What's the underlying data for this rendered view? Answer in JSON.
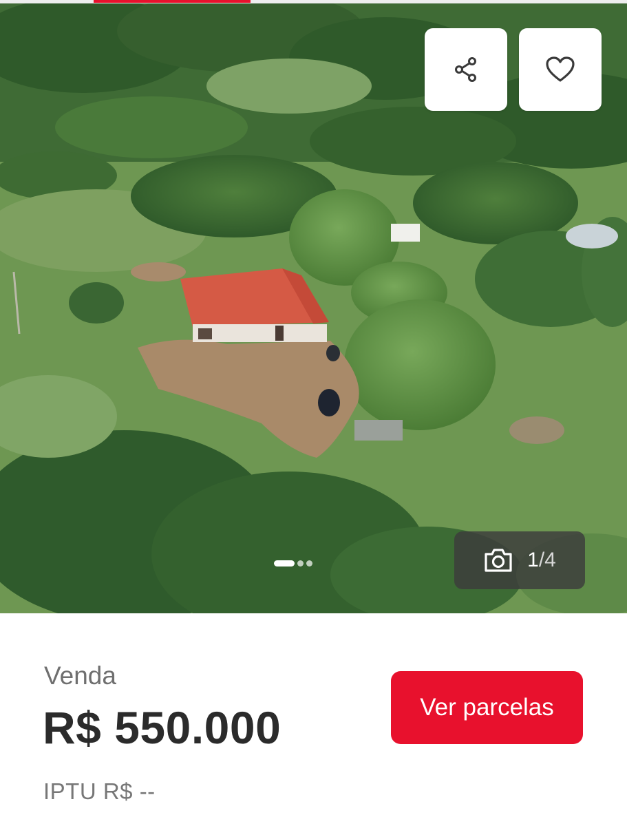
{
  "gallery": {
    "current": "1",
    "total": "/4",
    "icons": {
      "share": "share-icon",
      "favorite": "heart-icon",
      "camera": "camera-icon"
    }
  },
  "listing": {
    "deal_type": "Venda",
    "price": "R$ 550.000",
    "iptu": "IPTU R$ --"
  },
  "cta": {
    "label": "Ver parcelas"
  },
  "colors": {
    "accent": "#e8112d",
    "text": "#2b2b2b",
    "muted": "#777777"
  }
}
